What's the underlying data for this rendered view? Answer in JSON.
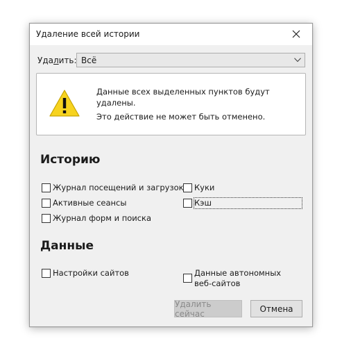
{
  "window": {
    "title": "Удаление всей истории",
    "close_icon": "close-icon"
  },
  "time_range": {
    "label_prefix": "Уда",
    "label_underlined": "л",
    "label_suffix": "ить:",
    "selected": "Всё"
  },
  "warning": {
    "icon": "warning-icon",
    "message": "Данные всех выделенных пунктов будут удалены.",
    "note": "Это действие не может быть отменено."
  },
  "history_section": {
    "title": "Историю",
    "items": [
      {
        "label": "Журнал посещений и загрузок",
        "checked": false
      },
      {
        "label": "Активные сеансы",
        "checked": false
      },
      {
        "label": "Журнал форм и поиска",
        "checked": false
      },
      {
        "label": "Куки",
        "checked": false
      },
      {
        "label": "Кэш",
        "checked": false,
        "focused": true
      }
    ]
  },
  "data_section": {
    "title": "Данные",
    "items": [
      {
        "label": "Настройки сайтов",
        "checked": false
      },
      {
        "label": "Данные автономных веб-сайтов",
        "checked": false
      }
    ]
  },
  "buttons": {
    "clear_now": "Удалить сейчас",
    "cancel": "Отмена"
  },
  "colors": {
    "dialog_bg": "#f0f0f0",
    "titlebar_bg": "#ffffff",
    "warning_yellow": "#f7d31f",
    "disabled_button_bg": "#cccccc"
  }
}
